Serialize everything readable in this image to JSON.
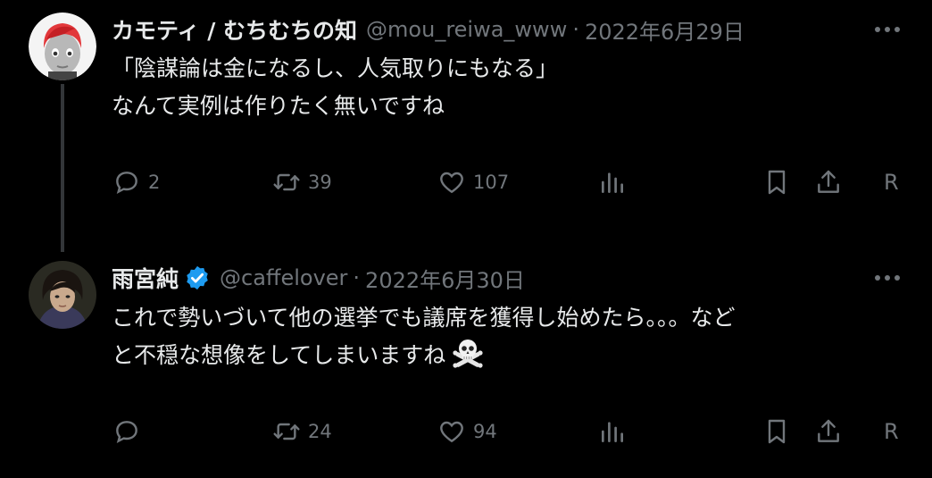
{
  "tweets": [
    {
      "author_name": "カモティ / むちむちの知",
      "handle": "@mou_reiwa_www",
      "separator": "·",
      "date": "2022年6月29日",
      "lines": [
        "「陰謀論は金になるし、人気取りにもなる」",
        "なんて実例は作りたく無いですね"
      ],
      "replies": "2",
      "retweets": "39",
      "likes": "107",
      "extra_label": "R",
      "verified": false
    },
    {
      "author_name": "雨宮純",
      "handle": "@caffelover",
      "separator": "·",
      "date": "2022年6月30日",
      "lines": [
        "これで勢いづいて他の選挙でも議席を獲得し始めたら。。。など",
        "と不穏な想像をしてしまいますね"
      ],
      "emoji": "skull-and-crossbones",
      "replies": "",
      "retweets": "24",
      "likes": "94",
      "extra_label": "R",
      "verified": true
    }
  ],
  "colors": {
    "background": "#000000",
    "text": "#e7e9ea",
    "muted": "#71767b",
    "verified_badge": "#1d9bf0",
    "thread_line": "#333639"
  },
  "icons": [
    "reply-icon",
    "retweet-icon",
    "like-icon",
    "views-icon",
    "bookmark-icon",
    "share-icon",
    "more-icon",
    "verified-badge-icon",
    "skull-crossbones-emoji"
  ]
}
